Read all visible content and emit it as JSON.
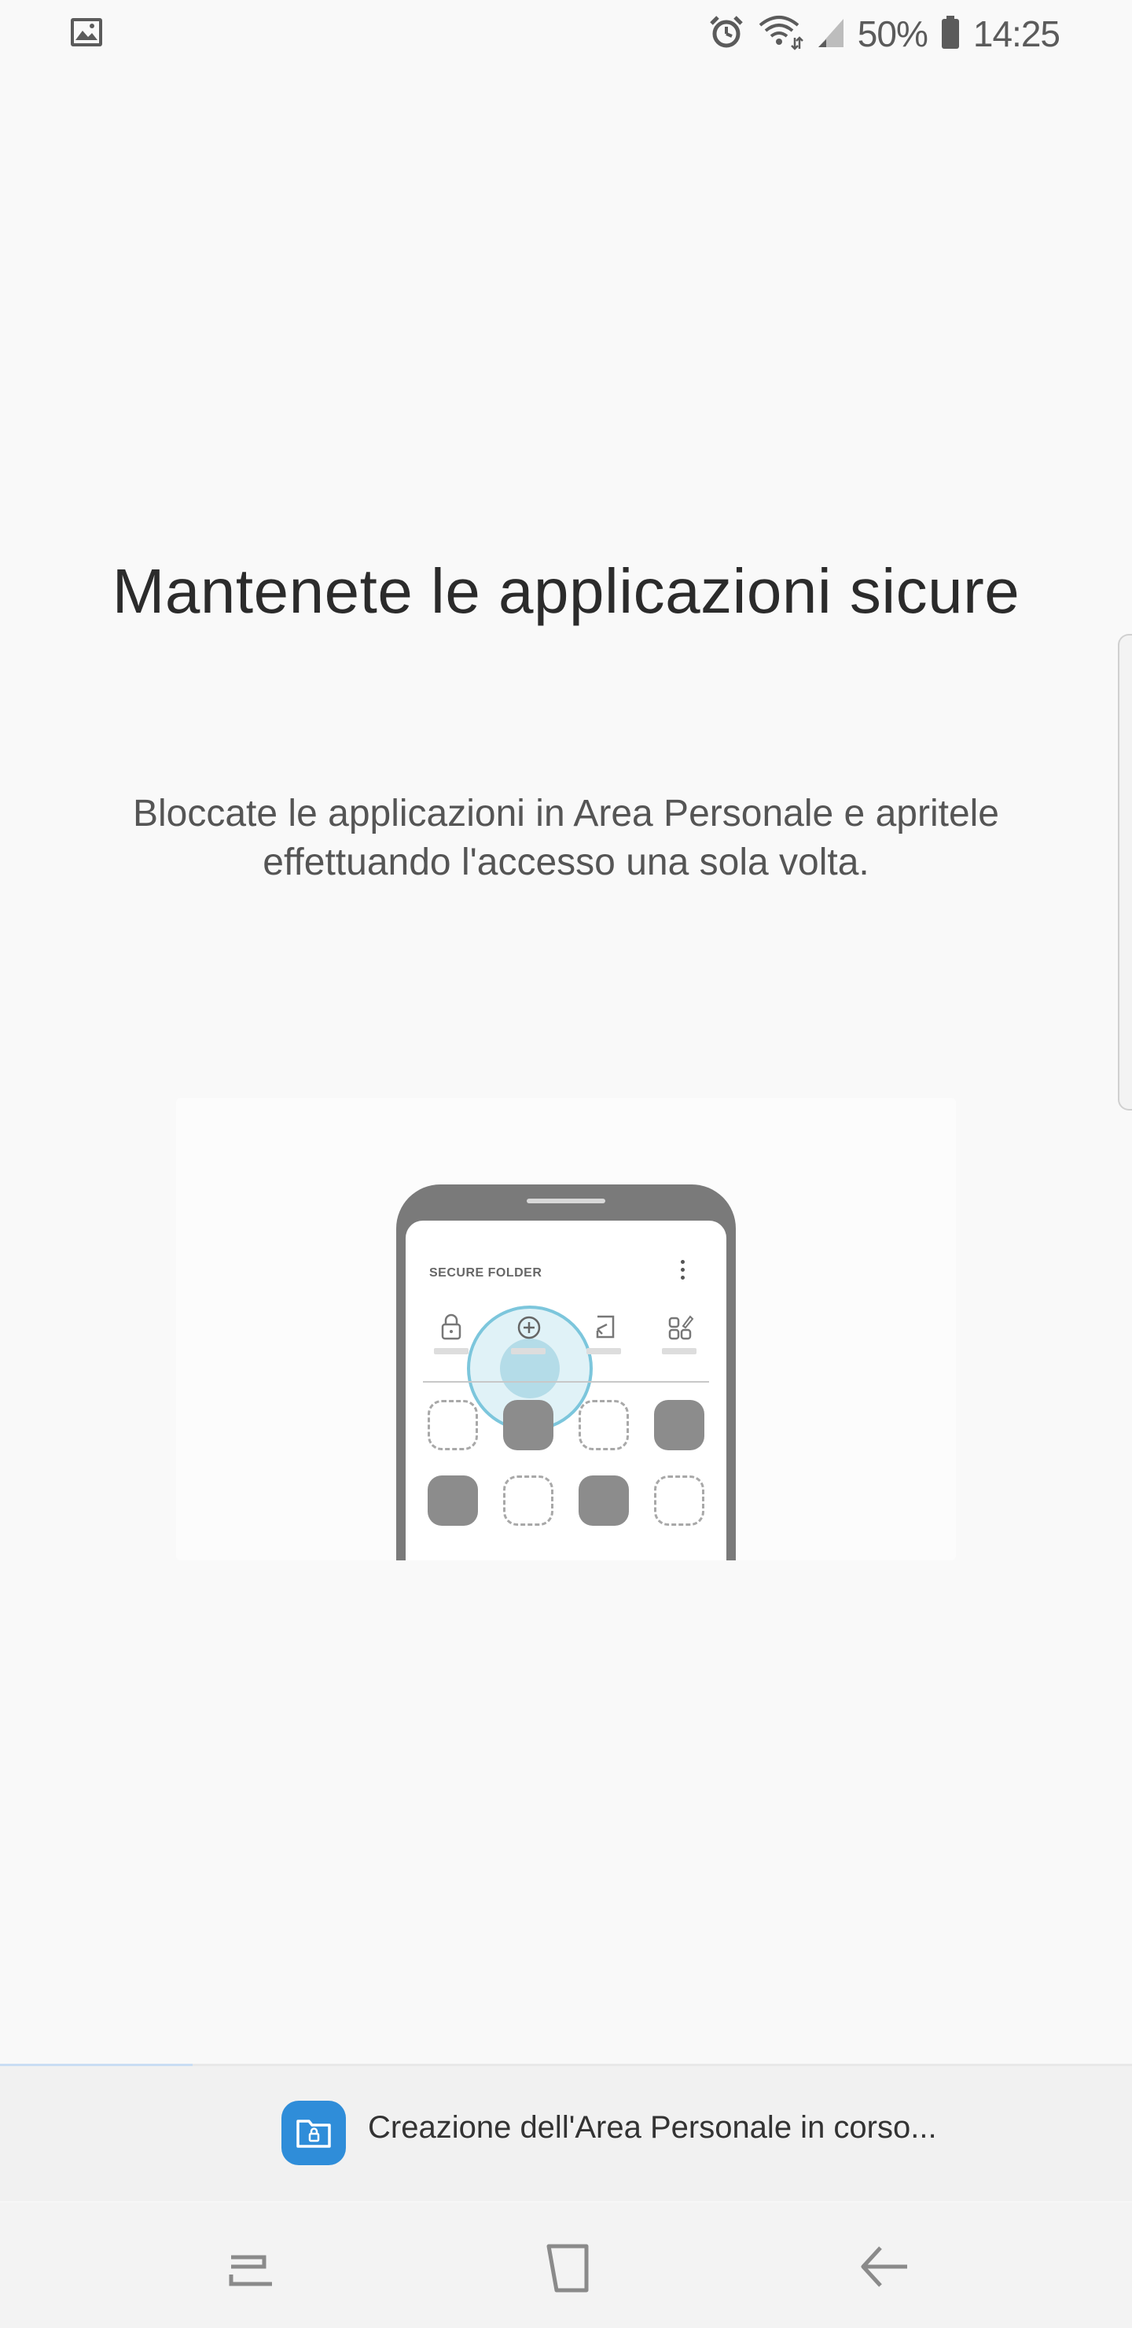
{
  "status_bar": {
    "left_icon": "image-icon",
    "battery_percent": "50%",
    "time": "14:25",
    "icons": [
      "alarm-icon",
      "wifi-icon",
      "signal-icon",
      "battery-icon"
    ]
  },
  "onboarding": {
    "title": "Mantenete le applicazioni sicure",
    "description": "Bloccate le applicazioni in Area Personale e apritele effettuando l'accesso una sola volta."
  },
  "illustration": {
    "header_label": "SECURE FOLDER",
    "icons": [
      "lock-icon",
      "add-icon",
      "import-icon",
      "apps-icon"
    ],
    "highlight_color": "#7cc6dc",
    "grid": [
      "empty",
      "filled",
      "empty",
      "filled",
      "filled",
      "empty",
      "filled",
      "empty"
    ]
  },
  "progress": {
    "fraction": 0.17,
    "color": "#c9ddf3"
  },
  "notification": {
    "icon": "secure-folder-icon",
    "icon_color": "#2f8dd9",
    "text": "Creazione dell'Area Personale in corso..."
  },
  "nav_bar": {
    "buttons": [
      "recents-button",
      "home-button",
      "back-button"
    ]
  }
}
